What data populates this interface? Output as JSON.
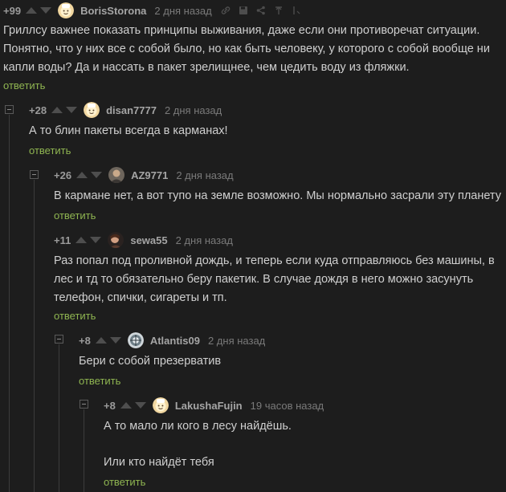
{
  "comments": [
    {
      "rating": "+99",
      "username": "BorisStorona",
      "time": "2 дня назад",
      "text": "Гриллсу важнее показать принципы выживания, даже если они противоречат ситуации. Понятно, что у них все с собой было, но как быть человеку, у которого с собой вообще ни капли воды? Да и нассать в пакет зрелищнее, чем цедить воду из фляжки.",
      "reply": "ответить",
      "avatar": "smiley-avatar"
    },
    {
      "rating": "+28",
      "username": "disan7777",
      "time": "2 дня назад",
      "text": "А то блин пакеты всегда в карманах!",
      "reply": "ответить",
      "avatar": "smiley-avatar"
    },
    {
      "rating": "+26",
      "username": "AZ9771",
      "time": "2 дня назад",
      "text": "В кармане нет, а вот тупо на земле возможно. Мы нормально засрали эту планету",
      "reply": "ответить",
      "avatar": "photo-avatar"
    },
    {
      "rating": "+11",
      "username": "sewa55",
      "time": "2 дня назад",
      "text": "Раз попал под проливной дождь, и теперь если куда отправляюсь без машины, в лес и тд то обязательно беру пакетик. В случае дождя в него можно засунуть телефон, спички, сигареты и тп.",
      "reply": "ответить",
      "avatar": "photo-avatar"
    },
    {
      "rating": "+8",
      "username": "Atlantis09",
      "time": "2 дня назад",
      "text": "Бери с собой презерватив",
      "reply": "ответить",
      "avatar": "photo-avatar"
    },
    {
      "rating": "+8",
      "username": "LakushaFujin",
      "time": "19 часов назад",
      "text1": "А то мало ли кого в лесу найдёшь.",
      "text2": "Или кто найдёт тебя",
      "reply": "ответить",
      "avatar": "smiley-avatar"
    }
  ],
  "colors": {
    "background": "#1d1d1d",
    "text": "#cfcfcf",
    "reply": "#8fb551",
    "username": "#a5a5a5",
    "muted": "#7a7a7a"
  },
  "icons": [
    "link-icon",
    "save-icon",
    "share-icon",
    "pin-icon",
    "more-icon"
  ]
}
